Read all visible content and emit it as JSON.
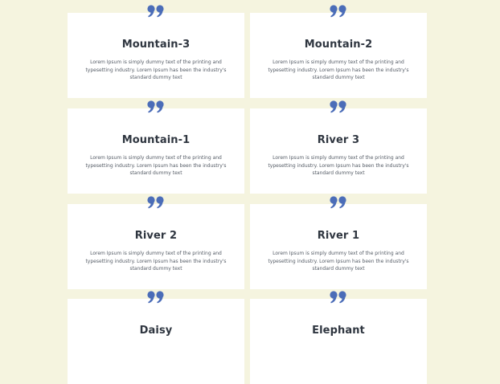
{
  "accent_color": "#4b6db8",
  "cards": [
    {
      "title": "Mountain-3",
      "icon": "quote-icon",
      "text": "Lorem Ipsum is simply dummy text of the printing and typesetting industry. Lorem Ipsum has been the industry's standard dummy text"
    },
    {
      "title": "Mountain-2",
      "icon": "quote-icon",
      "text": "Lorem Ipsum is simply dummy text of the printing and typesetting industry. Lorem Ipsum has been the industry's standard dummy text"
    },
    {
      "title": "Mountain-1",
      "icon": "quote-icon",
      "text": "Lorem Ipsum is simply dummy text of the printing and typesetting industry. Lorem Ipsum has been the industry's standard dummy text"
    },
    {
      "title": "River 3",
      "icon": "quote-icon",
      "text": "Lorem Ipsum is simply dummy text of the printing and typesetting industry. Lorem Ipsum has been the industry's standard dummy text"
    },
    {
      "title": "River 2",
      "icon": "quote-icon",
      "text": "Lorem Ipsum is simply dummy text of the printing and typesetting industry. Lorem Ipsum has been the industry's standard dummy text"
    },
    {
      "title": "River 1",
      "icon": "quote-icon",
      "text": "Lorem Ipsum is simply dummy text of the printing and typesetting industry. Lorem Ipsum has been the industry's standard dummy text"
    },
    {
      "title": "Daisy",
      "icon": "quote-icon",
      "text": ""
    },
    {
      "title": "Elephant",
      "icon": "quote-icon",
      "text": ""
    }
  ]
}
